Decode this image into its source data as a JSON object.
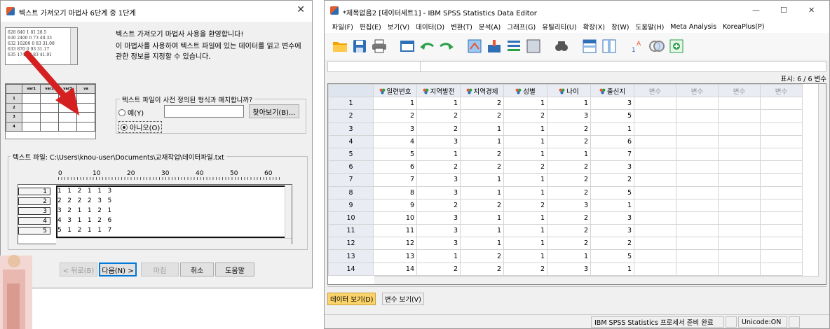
{
  "wizard": {
    "title": "텍스트 가져오기 마법사 6단계 중 1단계",
    "close_label": "✕",
    "intro_line1": "텍스트 가져오기 마법사 사용을 환영합니다!",
    "intro_line2": "이 마법사를 사용하여 텍스트 파일에 있는 데이터를 읽고 변수에 관한 정보를 지정할 수 있습니다.",
    "preview_lines": [
      "628 840 1 81 28.5",
      "630 2400 0 73 40.33",
      "632 10200 0 83 31.08",
      "633 870 0 93 31.17",
      "635 1740 0 83 41.91"
    ],
    "preview_grid_headers": [
      "var1",
      "var2",
      "var3",
      "va"
    ],
    "preview_grid_rows": [
      "1",
      "2",
      "3",
      "4"
    ],
    "format_question": "텍스트 파일이 사전 정의된 형식과 매치합니까?",
    "radio_yes": "예(Y)",
    "radio_no": "아니오(O)",
    "browse_label": "찾아보기(B)...",
    "file_label": "텍스트 파일: C:\\Users\\knou-user\\Documents\\교재작업\\데이터파일.txt",
    "ruler_marks": [
      "0",
      "10",
      "20",
      "30",
      "40",
      "50",
      "60"
    ],
    "file_rows": [
      {
        "num": "1",
        "text": "1   1   2   1   1   3"
      },
      {
        "num": "2",
        "text": "2   2   2   2   3   5"
      },
      {
        "num": "3",
        "text": "3   2   1   1   2   1"
      },
      {
        "num": "4",
        "text": "4   3   1   1   2   6"
      },
      {
        "num": "5",
        "text": "5   1   2   1   1   7"
      }
    ],
    "buttons": {
      "back": "< 뒤로(B)",
      "next": "다음(N) >",
      "finish": "마침",
      "cancel": "취소",
      "help": "도움말"
    }
  },
  "spss": {
    "title": "*제목없음2 [데이터세트1] - IBM SPSS Statistics Data Editor",
    "minimize": "—",
    "maximize": "☐",
    "close": "✕",
    "menu": [
      "파일(F)",
      "편집(E)",
      "보기(V)",
      "데이터(D)",
      "변환(T)",
      "분석(A)",
      "그래프(G)",
      "유틸리티(U)",
      "확장(X)",
      "창(W)",
      "도움말(H)",
      "Meta Analysis",
      "KoreaPlus(P)"
    ],
    "show_label": "표시: 6 / 6 변수",
    "columns": [
      "일련번호",
      "지역발전",
      "지역경제",
      "성별",
      "나이",
      "출신지"
    ],
    "empty_col_label": "변수",
    "empty_col_count": 4,
    "rows": [
      [
        "1",
        "1",
        "1",
        "2",
        "1",
        "1",
        "3"
      ],
      [
        "2",
        "2",
        "2",
        "2",
        "2",
        "3",
        "5"
      ],
      [
        "3",
        "3",
        "2",
        "1",
        "1",
        "2",
        "1"
      ],
      [
        "4",
        "4",
        "3",
        "1",
        "1",
        "2",
        "6"
      ],
      [
        "5",
        "5",
        "1",
        "2",
        "1",
        "1",
        "7"
      ],
      [
        "6",
        "6",
        "2",
        "2",
        "2",
        "2",
        "3"
      ],
      [
        "7",
        "7",
        "3",
        "1",
        "1",
        "2",
        "2"
      ],
      [
        "8",
        "8",
        "3",
        "1",
        "1",
        "2",
        "5"
      ],
      [
        "9",
        "9",
        "2",
        "2",
        "2",
        "3",
        "1"
      ],
      [
        "10",
        "10",
        "3",
        "1",
        "1",
        "2",
        "3"
      ],
      [
        "11",
        "11",
        "3",
        "1",
        "1",
        "2",
        "3"
      ],
      [
        "12",
        "12",
        "3",
        "1",
        "1",
        "2",
        "2"
      ],
      [
        "13",
        "13",
        "1",
        "2",
        "1",
        "1",
        "5"
      ],
      [
        "14",
        "14",
        "2",
        "2",
        "2",
        "3",
        "1"
      ]
    ],
    "tabs": {
      "data_view": "데이터 보기(D)",
      "variable_view": "변수 보기(V)"
    },
    "status": {
      "processor": "IBM SPSS Statistics 프로세서 준비 완료",
      "unicode": "Unicode:ON"
    }
  },
  "colors": {
    "accent": "#0078d7",
    "active_tab": "#fbd36b",
    "grid_header": "#e9edf3"
  }
}
